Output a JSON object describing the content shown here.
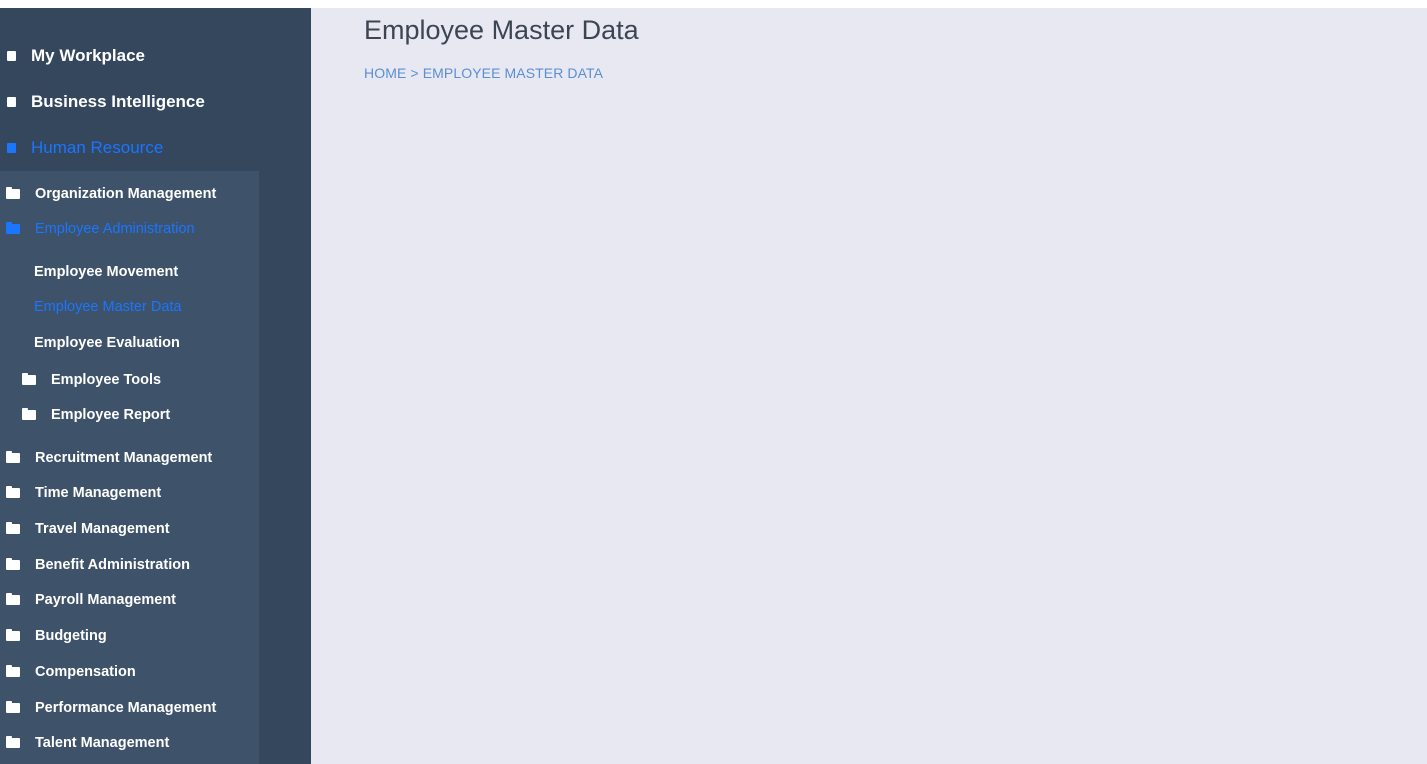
{
  "sidebar": {
    "top_items": [
      {
        "label": "My Workplace"
      },
      {
        "label": "Business Intelligence"
      },
      {
        "label": "Human Resource"
      }
    ],
    "hr_menu": [
      {
        "label": "Organization Management"
      },
      {
        "label": "Employee Administration"
      },
      {
        "label": "Employee Movement"
      },
      {
        "label": "Employee Master Data"
      },
      {
        "label": "Employee Evaluation"
      },
      {
        "label": "Employee Tools"
      },
      {
        "label": "Employee Report"
      },
      {
        "label": "Recruitment Management"
      },
      {
        "label": "Time Management"
      },
      {
        "label": "Travel Management"
      },
      {
        "label": "Benefit Administration"
      },
      {
        "label": "Payroll Management"
      },
      {
        "label": "Budgeting"
      },
      {
        "label": "Compensation"
      },
      {
        "label": "Performance Management"
      },
      {
        "label": "Talent Management"
      }
    ]
  },
  "page": {
    "title": "Employee Master Data",
    "breadcrumb": {
      "home": "HOME",
      "separator": ">",
      "current": "EMPLOYEE MASTER DATA"
    }
  },
  "colors": {
    "sidebar_bg": "#34475d",
    "submenu_bg": "#3e536a",
    "active": "#1a75ff",
    "content_bg": "#e8e8f2"
  }
}
